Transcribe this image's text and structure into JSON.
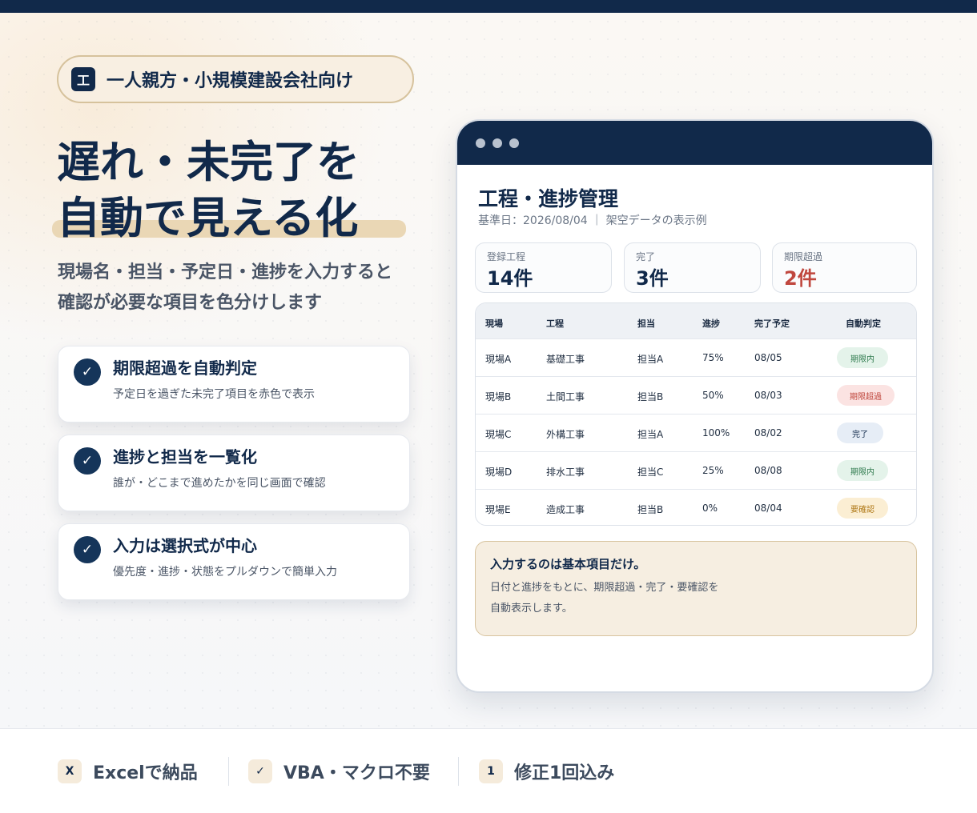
{
  "badge": {
    "icon": "工",
    "text": "一人親方・小規模建設会社向け"
  },
  "headline": {
    "line1": "遅れ・未完了を",
    "line2": "自動で見える化"
  },
  "subtext": {
    "line1": "現場名・担当・予定日・進捗を入力すると",
    "line2": "確認が必要な項目を色分けします"
  },
  "features": [
    {
      "title": "期限超過を自動判定",
      "desc": "予定日を過ぎた未完了項目を赤色で表示"
    },
    {
      "title": "進捗と担当を一覧化",
      "desc": "誰が・どこまで進めたかを同じ画面で確認"
    },
    {
      "title": "入力は選択式が中心",
      "desc": "優先度・進捗・状態をプルダウンで簡単入力"
    }
  ],
  "window": {
    "title": "工程・進捗管理",
    "subtitle": "基準日：2026/08/04 ｜ 架空データの表示例",
    "stats": [
      {
        "label": "登録工程",
        "value": "14件",
        "color": "#11294a"
      },
      {
        "label": "完了",
        "value": "3件",
        "color": "#11294a"
      },
      {
        "label": "期限超過",
        "value": "2件",
        "color": "#c0473e"
      }
    ],
    "table": {
      "headers": [
        "現場",
        "工程",
        "担当",
        "進捗",
        "完了予定",
        "自動判定"
      ],
      "rows": [
        {
          "site": "現場A",
          "process": "基礎工事",
          "owner": "担当A",
          "progress": "75%",
          "due": "08/05",
          "status": "期限内",
          "status_type": "ok"
        },
        {
          "site": "現場B",
          "process": "土間工事",
          "owner": "担当B",
          "progress": "50%",
          "due": "08/03",
          "status": "期限超過",
          "status_type": "over"
        },
        {
          "site": "現場C",
          "process": "外構工事",
          "owner": "担当A",
          "progress": "100%",
          "due": "08/02",
          "status": "完了",
          "status_type": "done"
        },
        {
          "site": "現場D",
          "process": "排水工事",
          "owner": "担当C",
          "progress": "25%",
          "due": "08/08",
          "status": "期限内",
          "status_type": "ok"
        },
        {
          "site": "現場E",
          "process": "造成工事",
          "owner": "担当B",
          "progress": "0%",
          "due": "08/04",
          "status": "要確認",
          "status_type": "check"
        }
      ]
    },
    "note": {
      "title": "入力するのは基本項目だけ。",
      "line1": "日付と進捗をもとに、期限超過・完了・要確認を",
      "line2": "自動表示します。"
    }
  },
  "footer": [
    {
      "icon": "X",
      "label": "Excelで納品"
    },
    {
      "icon": "✓",
      "label": "VBA・マクロ不要"
    },
    {
      "icon": "1",
      "label": "修正1回込み"
    }
  ],
  "colors": {
    "navy": "#11294a",
    "accent_beige": "#ead7b5",
    "status_ok_bg": "#e4f3ea",
    "status_ok_fg": "#2e7a4d",
    "status_over_bg": "#fbe3e2",
    "status_over_fg": "#c0473e",
    "status_done_bg": "#e6edf6",
    "status_done_fg": "#11294a",
    "status_check_bg": "#fbeed3",
    "status_check_fg": "#b07a1a"
  }
}
